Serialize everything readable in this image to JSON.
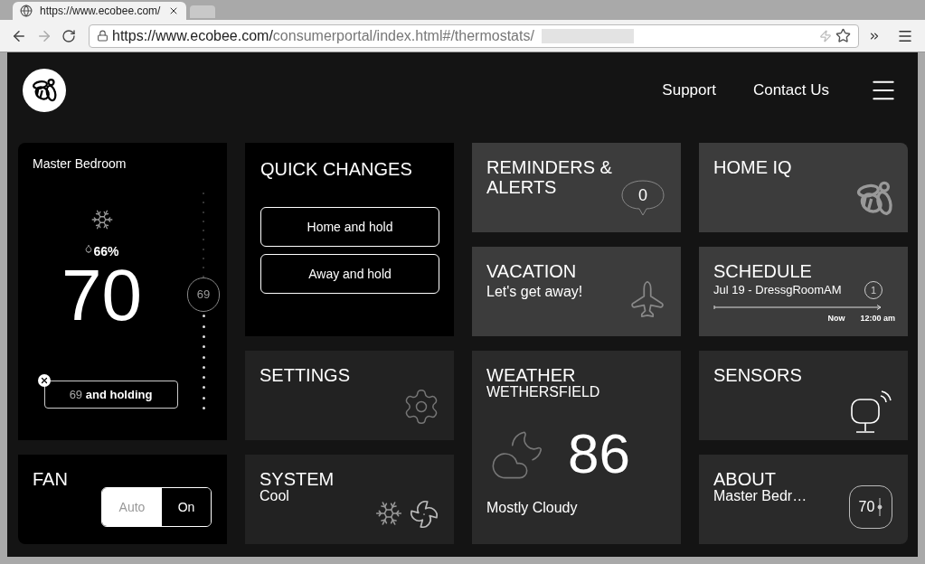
{
  "browser": {
    "tab_title": "https://www.ecobee.com/",
    "url_host": "https://www.ecobee.com/",
    "url_path": "consumerportal/index.html#/thermostats/"
  },
  "header": {
    "nav": [
      "Support",
      "Contact Us"
    ]
  },
  "thermostat": {
    "name": "Master Bedroom",
    "humidity": "66%",
    "temperature": "70",
    "setpoint": "69",
    "slider": {
      "level": 0.53
    },
    "hold": {
      "setpoint": "69",
      "text": "and holding"
    }
  },
  "quick_changes": {
    "title": "QUICK CHANGES",
    "buttons": [
      "Home and hold",
      "Away and hold"
    ]
  },
  "fan": {
    "title": "FAN",
    "options": [
      {
        "label": "Auto",
        "selected": false
      },
      {
        "label": "On",
        "selected": true
      }
    ]
  },
  "settings": {
    "title": "SETTINGS"
  },
  "system": {
    "title": "SYSTEM",
    "mode": "Cool"
  },
  "reminders": {
    "title": "REMINDERS & ALERTS",
    "count": "0"
  },
  "vacation": {
    "title": "VACATION",
    "subtitle": "Let's get away!"
  },
  "weather": {
    "title": "WEATHER",
    "location": "WETHERSFIELD",
    "temperature": "86",
    "condition": "Mostly Cloudy"
  },
  "home_iq": {
    "title": "HOME IQ"
  },
  "schedule": {
    "title": "SCHEDULE",
    "event": "Jul 19 - DressgRoomAM",
    "period": "1",
    "start": "Now",
    "end": "12:00 am"
  },
  "sensors": {
    "title": "SENSORS"
  },
  "about": {
    "title": "ABOUT",
    "device": "Master Bedr…",
    "temperature": "70"
  }
}
